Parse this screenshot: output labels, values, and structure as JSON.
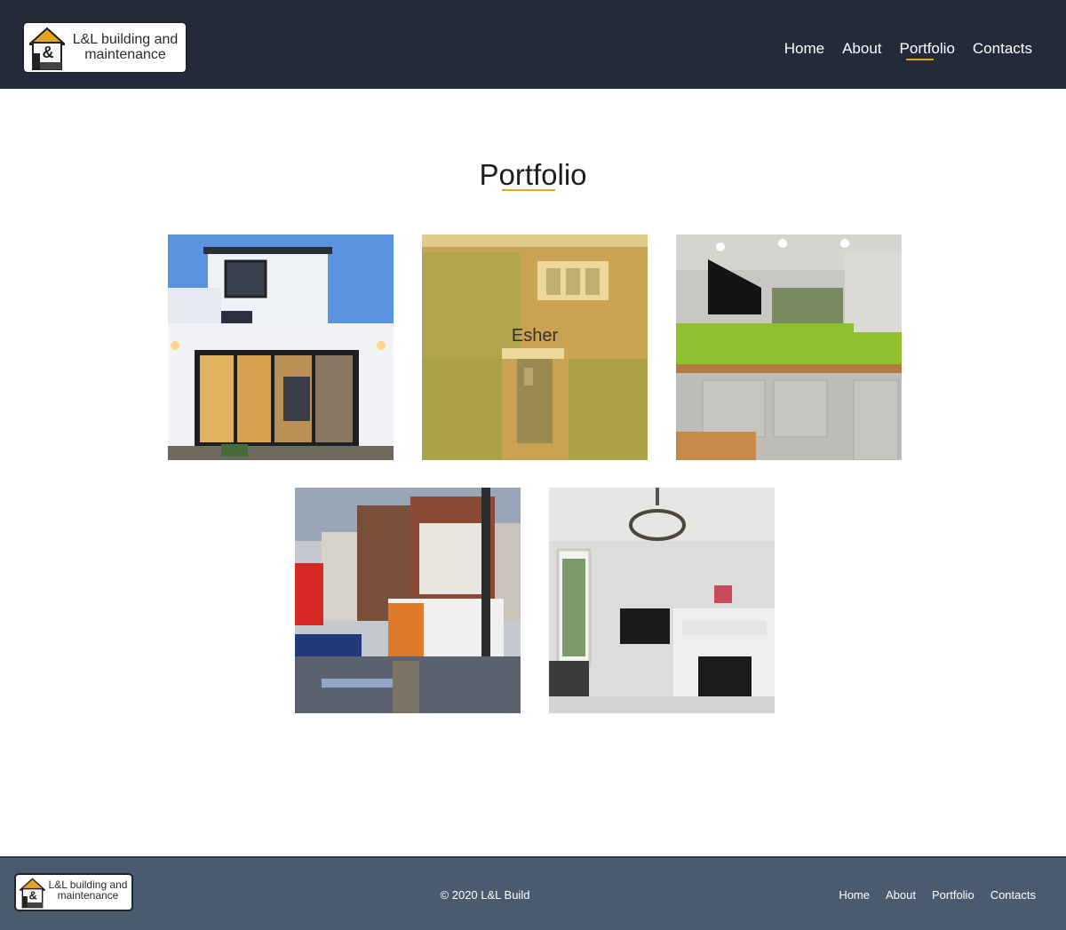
{
  "header": {
    "logo_text": "L&L building and maintenance",
    "logo_mark": "&",
    "nav": [
      {
        "label": "Home"
      },
      {
        "label": "About"
      },
      {
        "label": "Portfolio",
        "active": true
      },
      {
        "label": "Contacts"
      }
    ]
  },
  "main": {
    "title": "Portfolio",
    "gallery": [
      {
        "photo": "house-extension-dusk"
      },
      {
        "photo": "brick-house-front-door",
        "overlay_label": "Esher"
      },
      {
        "photo": "kitchen-green-tiles"
      },
      {
        "photo": "street-corner-buildings"
      },
      {
        "photo": "living-room-fireplace"
      }
    ]
  },
  "footer": {
    "logo_text": "L&L building and maintenance",
    "logo_mark": "&",
    "copyright": "© 2020 L&L Build",
    "nav": [
      {
        "label": "Home"
      },
      {
        "label": "About"
      },
      {
        "label": "Portfolio"
      },
      {
        "label": "Contacts"
      }
    ]
  },
  "colors": {
    "header_bg": "#232b3b",
    "footer_bg": "#4a5a6f",
    "accent": "#e8a321"
  }
}
